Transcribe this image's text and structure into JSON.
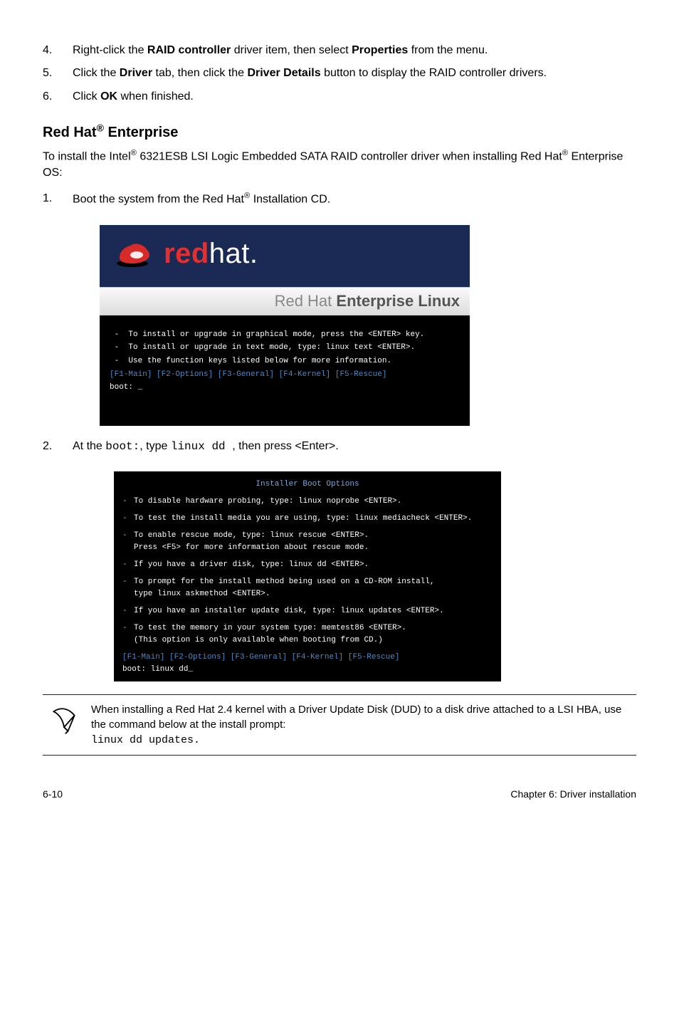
{
  "steps_top": [
    {
      "num": "4.",
      "html_parts": [
        "Right-click the ",
        {
          "b": "RAID controller"
        },
        " driver item, then select ",
        {
          "b": "Properties"
        },
        " from the menu."
      ]
    },
    {
      "num": "5.",
      "html_parts": [
        "Click the ",
        {
          "b": "Driver"
        },
        " tab, then click the ",
        {
          "b": "Driver Details"
        },
        " button to display the RAID controller drivers."
      ]
    },
    {
      "num": "6.",
      "html_parts": [
        "Click ",
        {
          "b": "OK"
        },
        " when finished."
      ]
    }
  ],
  "section_heading": "Red Hat® Enterprise",
  "lead": "To install the Intel® 6321ESB LSI Logic Embedded SATA RAID controller driver when installing Red Hat® Enterprise OS:",
  "step1": {
    "num": "1.",
    "text": "Boot the system from the Red Hat® Installation CD."
  },
  "rh_banner": {
    "brand_red": "red",
    "brand_hat": "hat",
    "brand_dot": ".",
    "subbar_light": "Red Hat ",
    "subbar_heavy": "Enterprise Linux",
    "lines": [
      " -  To install or upgrade in graphical mode, press the <ENTER> key.",
      " -  To install or upgrade in text mode, type: linux text <ENTER>.",
      " -  Use the function keys listed below for more information."
    ],
    "fkeys": "[F1-Main] [F2-Options] [F3-General] [F4-Kernel] [F5-Rescue]",
    "boot": "boot: _"
  },
  "step2": {
    "num": "2.",
    "prefix": "At the ",
    "code1": "boot:",
    "mid": ", type ",
    "code2": "linux dd ",
    "suffix": ", then press <Enter>."
  },
  "opts": {
    "title": "Installer Boot Options",
    "items": [
      "To disable hardware probing, type: linux noprobe <ENTER>.",
      "To test the install media you are using, type: linux mediacheck <ENTER>.",
      "To enable rescue mode, type: linux rescue <ENTER>.\nPress <F5> for more information about rescue mode.",
      "If you have a driver disk, type: linux dd <ENTER>.",
      "To prompt for the install method being used on a CD-ROM install,\ntype linux askmethod <ENTER>.",
      "If you have an installer update disk, type: linux updates <ENTER>.",
      "To test the memory in your system type: memtest86 <ENTER>.\n(This option is only available when booting from CD.)"
    ],
    "fkeys": "[F1-Main] [F2-Options] [F3-General] [F4-Kernel] [F5-Rescue]",
    "boot": "boot: linux dd_"
  },
  "note": {
    "text": "When installing a Red Hat 2.4 kernel with a Driver Update Disk (DUD) to a disk drive attached to a LSI HBA, use the command below at the install prompt:",
    "code": "linux dd updates."
  },
  "footer": {
    "left": "6-10",
    "right": "Chapter 6: Driver installation"
  }
}
